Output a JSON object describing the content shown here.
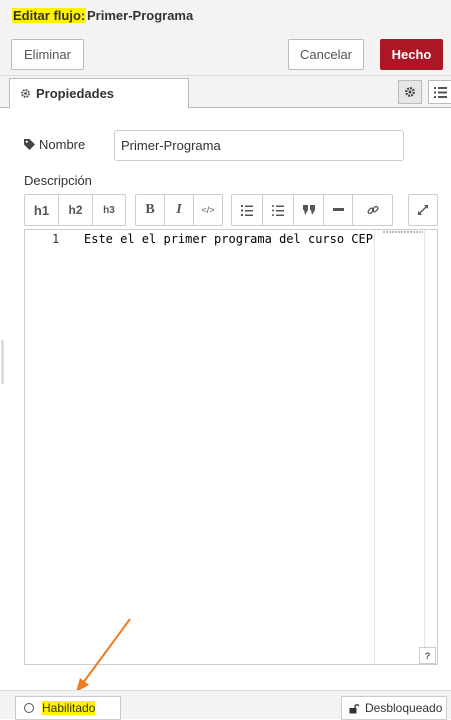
{
  "header": {
    "title_prefix": "Editar flujo:",
    "title_name": "Primer-Programa"
  },
  "toolbar": {
    "delete_label": "Eliminar",
    "cancel_label": "Cancelar",
    "done_label": "Hecho",
    "done_color": "#ad1625"
  },
  "tabs": {
    "properties_label": "Propiedades"
  },
  "form": {
    "name_label": "Nombre",
    "name_value": "Primer-Programa",
    "description_label": "Descripción"
  },
  "editor_toolbar": {
    "headings": [
      "h1",
      "h2",
      "h3"
    ],
    "bold": "B",
    "italic": "I",
    "code": "</>"
  },
  "editor": {
    "line_number": "1",
    "line_text": "Este el el primer programa del curso CEP",
    "help": "?"
  },
  "footer": {
    "enabled_label": "Habilitado",
    "lock_label": "Desbloqueado",
    "highlight_color": "#fff200"
  }
}
